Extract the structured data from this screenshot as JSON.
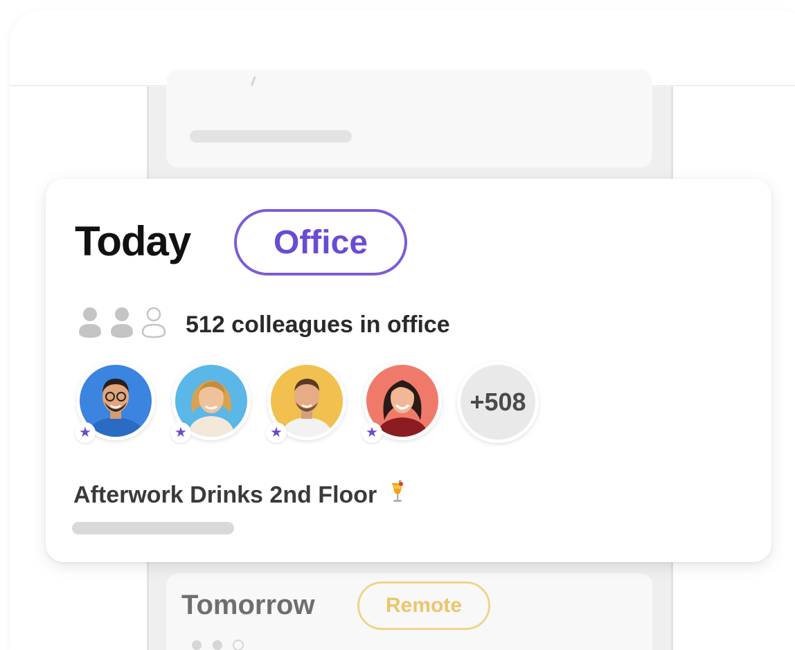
{
  "today_card": {
    "title": "Today",
    "status_badge": "Office",
    "attendance_text": "512 colleagues in office",
    "more_count": "+508",
    "event_text": "Afterwork Drinks 2nd Floor",
    "event_emoji": "cocktail-icon"
  },
  "tomorrow_card": {
    "title": "Tomorrow",
    "status_badge": "Remote"
  },
  "colors": {
    "accent_purple": "#6a4bd4",
    "remote_yellow": "#ecc56a",
    "avatar_bg_1": "#3b84e0",
    "avatar_bg_2": "#5ab7e8",
    "avatar_bg_3": "#f1c04f",
    "avatar_bg_4": "#f07a6a"
  }
}
